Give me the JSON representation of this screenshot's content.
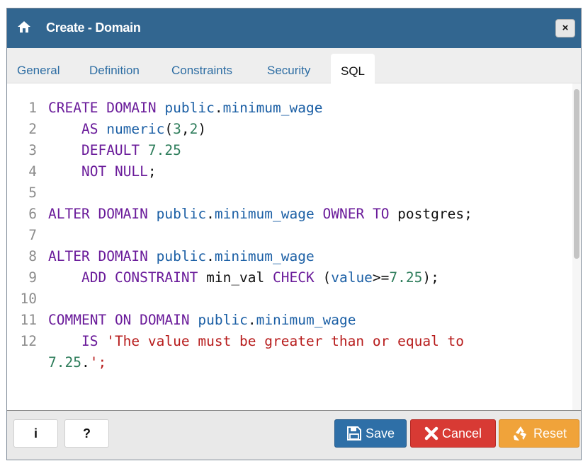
{
  "dialog": {
    "title": "Create - Domain",
    "close_label": "×"
  },
  "tabs": [
    {
      "label": "General"
    },
    {
      "label": "Definition"
    },
    {
      "label": "Constraints"
    },
    {
      "label": "Security"
    },
    {
      "label": "SQL",
      "active": true
    }
  ],
  "editor": {
    "lines": [
      {
        "n": "1",
        "code": "CREATE DOMAIN public.minimum_wage"
      },
      {
        "n": "2",
        "code": "    AS numeric(3,2)"
      },
      {
        "n": "3",
        "code": "    DEFAULT 7.25"
      },
      {
        "n": "4",
        "code": "    NOT NULL;"
      },
      {
        "n": "5",
        "code": ""
      },
      {
        "n": "6",
        "code": "ALTER DOMAIN public.minimum_wage OWNER TO postgres;"
      },
      {
        "n": "7",
        "code": ""
      },
      {
        "n": "8",
        "code": "ALTER DOMAIN public.minimum_wage"
      },
      {
        "n": "9",
        "code": "    ADD CONSTRAINT min_val CHECK (value>=7.25);"
      },
      {
        "n": "10",
        "code": ""
      },
      {
        "n": "11",
        "code": "COMMENT ON DOMAIN public.minimum_wage"
      },
      {
        "n": "12",
        "code": "    IS 'The value must be greater than or equal to"
      },
      {
        "n": "",
        "code": "7.25.';"
      }
    ]
  },
  "footer": {
    "info_label": "i",
    "help_label": "?",
    "save_label": "Save",
    "cancel_label": "Cancel",
    "reset_label": "Reset"
  },
  "colors": {
    "titlebar": "#326690",
    "keyword": "#6a1b9a",
    "identifier": "#1b5fa5",
    "number": "#2e7d5b",
    "string": "#b71c1c",
    "save": "#2e6fa7",
    "cancel": "#d83a34",
    "reset": "#f0a33a"
  }
}
